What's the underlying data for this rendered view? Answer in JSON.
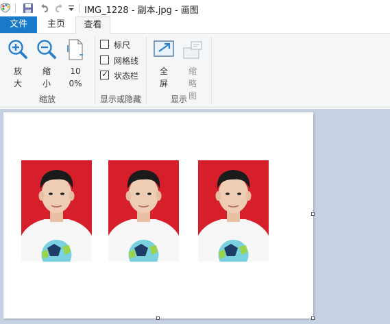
{
  "titlebar": {
    "title": "IMG_1228 - 副本.jpg - 画图",
    "icons": [
      "paint-app-icon",
      "save-icon",
      "undo-icon",
      "redo-icon",
      "customize-qat-icon"
    ]
  },
  "tabs": {
    "file": "文件",
    "home": "主页",
    "view": "查看"
  },
  "ribbon": {
    "zoom_group": {
      "label": "缩放",
      "zoom_in": "放大",
      "zoom_out": "缩小",
      "actual_size": "100%"
    },
    "show_hide_group": {
      "label": "显示或隐藏",
      "rulers": {
        "label": "标尺",
        "checked": false
      },
      "gridlines": {
        "label": "网格线",
        "checked": false
      },
      "status_bar": {
        "label": "状态栏",
        "checked": true
      }
    },
    "display_group": {
      "label": "显示",
      "full_screen": "全屏",
      "thumbnail": "缩略图"
    }
  },
  "canvas": {
    "photos": [
      "student-portrait-1",
      "student-portrait-2",
      "student-portrait-3"
    ],
    "background_color": "#d71f2c"
  }
}
